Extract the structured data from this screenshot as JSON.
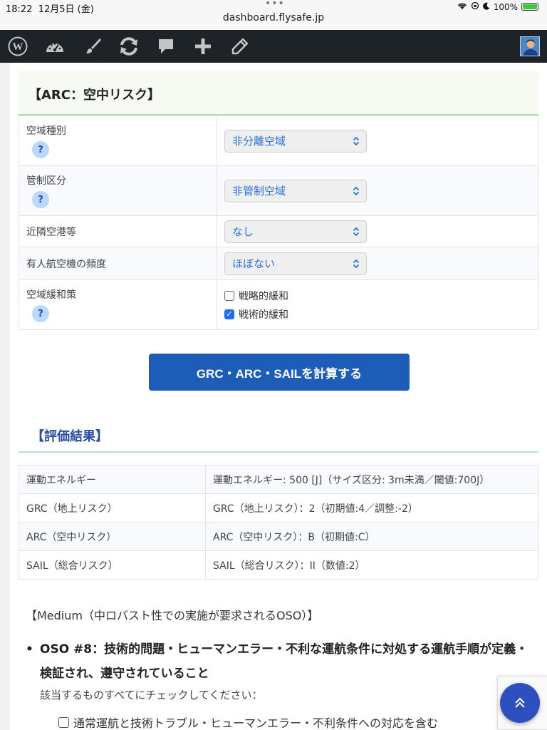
{
  "status_bar": {
    "time": "18:22",
    "date": "12月5日 (金)",
    "dots": "•••",
    "url": "dashboard.flysafe.jp",
    "battery": "100%",
    "battery_level": 1.0
  },
  "admin_bar": {
    "icons": [
      "wordpress-icon",
      "dashboard-icon",
      "customize-brush-icon",
      "updates-icon",
      "comments-icon",
      "new-content-icon",
      "edit-pencil-icon"
    ]
  },
  "arc_section": {
    "title": "【ARC：空中リスク】",
    "rows": [
      {
        "label": "空域種別",
        "type": "select",
        "value": "非分離空域",
        "help": "?"
      },
      {
        "label": "管制区分",
        "type": "select",
        "value": "非管制空域",
        "help": "?"
      },
      {
        "label": "近隣空港等",
        "type": "select",
        "value": "なし"
      },
      {
        "label": "有人航空機の頻度",
        "type": "select",
        "value": "ほぼない"
      },
      {
        "label": "空域緩和策",
        "type": "checkboxes",
        "help": "?",
        "options": [
          {
            "label": "戦略的緩和",
            "checked": false
          },
          {
            "label": "戦術的緩和",
            "checked": true
          }
        ]
      }
    ]
  },
  "calc_button": "GRC・ARC・SAILを計算する",
  "results": {
    "title": "【評価結果】",
    "rows": [
      {
        "label": "運動エネルギー",
        "value": "運動エネルギー: 500 [J]（サイズ区分: 3m未満／閾値:700J）"
      },
      {
        "label": "GRC（地上リスク）",
        "value": "GRC（地上リスク）：2（初期値:4／調整:-2）"
      },
      {
        "label": "ARC（空中リスク）",
        "value": "ARC（空中リスク）：B（初期値:C）"
      },
      {
        "label": "SAIL（総合リスク）",
        "value": "SAIL（総合リスク）：II（数値:2）"
      }
    ]
  },
  "oso": {
    "medium_title": "【Medium（中ロバスト性での実施が要求されるOSO）】",
    "bullet": "•",
    "item_title": "OSO #8：技術的問題・ヒューマンエラー・不利な運航条件に対処する運航手順が定義・検証され、遵守されていること",
    "instruction": "該当するものすべてにチェックしてください：",
    "first_option": "通常運航と技術トラブル・ヒューマンエラー・不利条件への対応を含む"
  },
  "scroll_top_icon": "double-chevron-up-icon"
}
